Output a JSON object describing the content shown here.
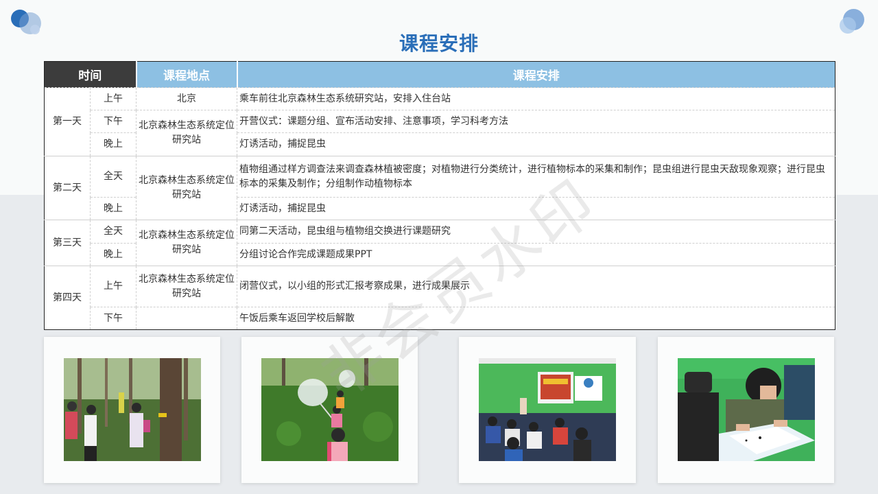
{
  "title": "课程安排",
  "headers": {
    "time": "时间",
    "place": "课程地点",
    "plan": "课程安排"
  },
  "days": [
    {
      "name": "第一天"
    },
    {
      "name": "第二天"
    },
    {
      "name": "第三天"
    },
    {
      "name": "第四天"
    }
  ],
  "rows": [
    {
      "period": "上午",
      "plan": "乘车前往北京森林生态系统研究站，安排入住台站"
    },
    {
      "period": "下午",
      "plan": "开营仪式：课题分组、宣布活动安排、注意事项，学习科考方法"
    },
    {
      "period": "晚上",
      "plan": "灯诱活动，捕捉昆虫"
    },
    {
      "period": "全天",
      "plan": "植物组通过样方调查法来调查森林植被密度；对植物进行分类统计，进行植物标本的采集和制作；昆虫组进行昆虫天敌现象观察；进行昆虫标本的采集及制作；分组制作动植物标本"
    },
    {
      "period": "晚上",
      "plan": "灯诱活动，捕捉昆虫"
    },
    {
      "period": "全天",
      "plan": "同第二天活动，昆虫组与植物组交换进行课题研究"
    },
    {
      "period": "晚上",
      "plan": "分组讨论合作完成课题成果PPT"
    },
    {
      "period": "上午",
      "plan": "闭营仪式，以小组的形式汇报考察成果，进行成果展示"
    },
    {
      "period": "下午",
      "plan": "午饭后乘车返回学校后解散"
    }
  ],
  "places": {
    "beijing": "北京",
    "station": "北京森林生态系统定位研究站"
  },
  "watermark": "非会员水印",
  "colors": {
    "title": "#2a6eb8",
    "header_dark": "#3c3c3c",
    "header_light": "#8dc0e3"
  }
}
